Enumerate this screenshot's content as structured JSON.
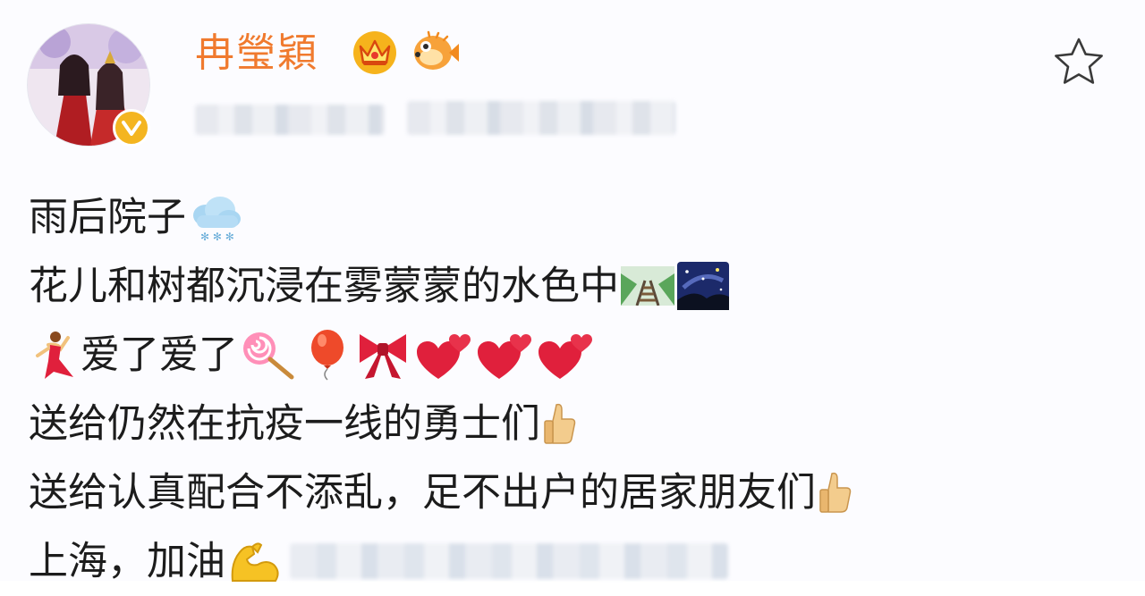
{
  "header": {
    "username": "冉瑩穎",
    "badges": [
      "crown-icon",
      "pufferfish-icon"
    ],
    "avatar_badge": "verified-badge-icon",
    "meta_text_redacted": true,
    "favorite_icon": "star-outline-icon"
  },
  "post": {
    "lines": [
      {
        "text": "雨后院子",
        "emojis": [
          "snow-cloud-icon"
        ]
      },
      {
        "text": "花儿和树都沉浸在雾蒙蒙的水色中",
        "emojis": [
          "railway-track-icon",
          "night-sky-icon"
        ]
      },
      {
        "text": "爱了爱了",
        "lead_emoji": "dancer-icon",
        "emojis": [
          "lollipop-icon",
          "balloon-icon",
          "ribbon-icon",
          "two-hearts-icon",
          "two-hearts-icon",
          "two-hearts-icon"
        ]
      },
      {
        "text": "送给仍然在抗疫一线的勇士们",
        "emojis": [
          "thumbs-up-icon"
        ]
      },
      {
        "text": "送给认真配合不添乱，足不出户的居家朋友们",
        "emojis": [
          "thumbs-up-icon"
        ]
      },
      {
        "text": "上海，加油",
        "emojis": [
          "flexed-biceps-icon"
        ],
        "redacted_tail": true
      }
    ]
  },
  "colors": {
    "username": "#f07a2e",
    "verified": "#f4b520",
    "heart": "#e0203c"
  }
}
